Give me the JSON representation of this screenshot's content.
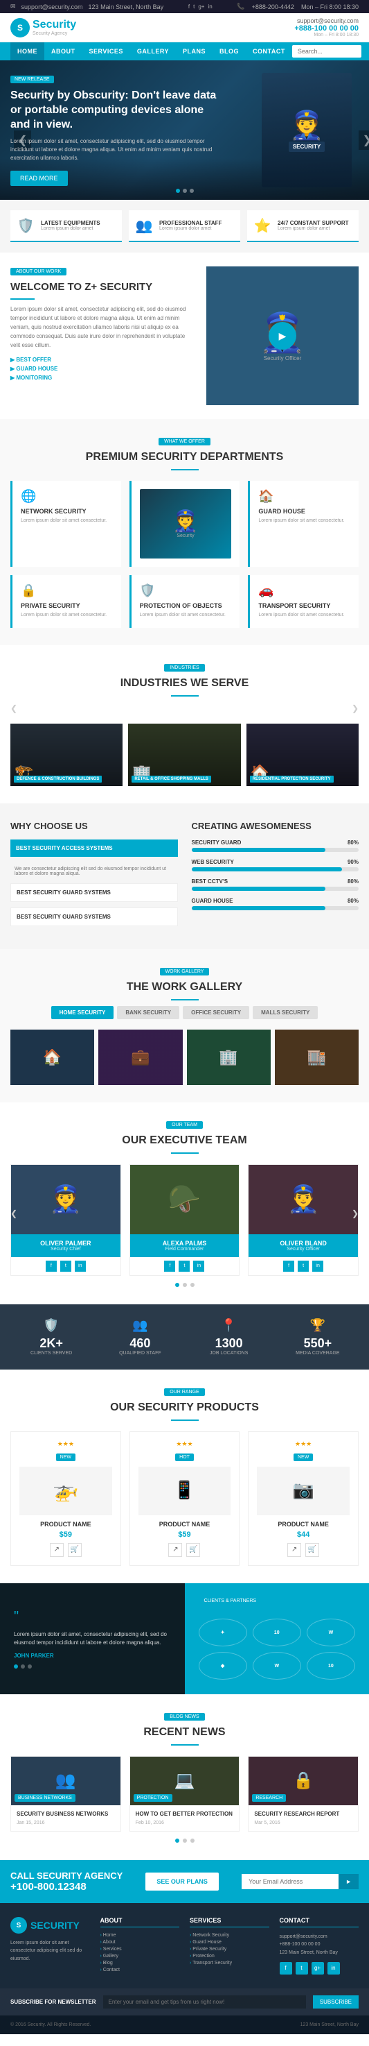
{
  "topbar": {
    "email": "support@security.com",
    "address": "123 Main Street, North Bay",
    "phone_label": "+888-200-4442",
    "hours": "Mon – Fri 8:00 18:30",
    "social": [
      "f",
      "t",
      "g+",
      "in"
    ]
  },
  "header": {
    "logo_name": "Security",
    "tagline": "Security Agency",
    "contact_label": "support@security.com",
    "phone": "+888-100 00 00 00",
    "hours": "Mon – Fri 8:00 18:30"
  },
  "nav": {
    "items": [
      "Home",
      "About",
      "Services",
      "Gallery",
      "Plans",
      "Blog",
      "Contact"
    ],
    "search_placeholder": "Search..."
  },
  "hero": {
    "badge": "NEW RELEASE",
    "title": "Security by Obscurity: Don't leave data or portable computing devices alone and in view.",
    "text": "Lorem ipsum dolor sit amet, consectetur adipiscing elit, sed do eiusmod tempor incididunt ut labore et dolore magna aliqua. Ut enim ad minim veniam quis nostrud exercitation ullamco laboris.",
    "btn_label": "READ MORE",
    "dots": 3,
    "figure_text": "SECURITY"
  },
  "features": [
    {
      "icon": "🛡️",
      "title": "LATEST EQUIPMENTS",
      "text": "Lorem ipsum dolor amet"
    },
    {
      "icon": "👥",
      "title": "PROFESSIONAL STAFF",
      "text": "Lorem ipsum dolor amet"
    },
    {
      "icon": "⭐",
      "title": "24/7 CONSTANT SUPPORT",
      "text": "Lorem ipsum dolor amet"
    }
  ],
  "welcome": {
    "badge": "ABOUT OUR WORK",
    "title": "WELCOME TO Z+ SECURITY",
    "text": "Lorem ipsum dolor sit amet, consectetur adipiscing elit, sed do eiusmod tempor incididunt ut labore et dolore magna aliqua. Ut enim ad minim veniam, quis nostrud exercitation ullamco laboris nisi ut aliquip ex ea commodo consequat. Duis aute irure dolor in reprehenderit in voluptate velit esse cillum.",
    "links": [
      "BEST OFFER",
      "GUARD HOUSE",
      "MONITORING"
    ]
  },
  "departments": {
    "badge": "WHAT WE OFFER",
    "title": "PREMIUM SECURITY DEPARTMENTS",
    "items": [
      {
        "icon": "🌐",
        "title": "NETWORK SECURITY",
        "text": "Lorem ipsum dolor sit amet consectetur."
      },
      {
        "icon": "🏠",
        "title": "GUARD HOUSE",
        "text": "Lorem ipsum dolor sit amet consectetur."
      },
      {
        "icon": "🔒",
        "title": "PRIVATE SECURITY",
        "text": "Lorem ipsum dolor sit amet consectetur."
      },
      {
        "icon": "🛡️",
        "title": "PROTECTION OF OBJECTS",
        "text": "Lorem ipsum dolor sit amet consectetur."
      },
      {
        "icon": "🚗",
        "title": "TRANSPORT SECURITY",
        "text": "Lorem ipsum dolor sit amet consectetur."
      }
    ]
  },
  "industries": {
    "badge": "INDUSTRIES",
    "title": "INDUSTRIES WE SERVE",
    "items": [
      {
        "label": "DEFENCE & CONSTRUCTION BUILDINGS",
        "color": "#3a4a5a"
      },
      {
        "label": "RETAIL & OFFICE SHOPPING MALLS",
        "color": "#4a5a3a"
      },
      {
        "label": "RESIDENTIAL PROTECTION SECURITY",
        "color": "#3a3a5a"
      }
    ]
  },
  "whychoose": {
    "title": "WHY CHOOSE US",
    "items": [
      {
        "text": "BEST SECURITY ACCESS SYSTEMS",
        "active": true
      },
      {
        "text": "BEST SECURITY GUARD SYSTEMS",
        "active": false
      },
      {
        "text": "BEST SECURITY GUARD SYSTEMS",
        "active": false
      }
    ]
  },
  "skills": {
    "title": "CREATING AWESOMENESS",
    "items": [
      {
        "label": "SECURITY GUARD",
        "percent": 80
      },
      {
        "label": "WEB SECURITY",
        "percent": 90
      },
      {
        "label": "BEST CCTV'S",
        "percent": 80
      },
      {
        "label": "GUARD HOUSE",
        "percent": 80
      }
    ]
  },
  "gallery": {
    "badge": "WORK GALLERY",
    "title": "THE WORK GALLERY",
    "tabs": [
      "HOME SECURITY",
      "BANK SECURITY",
      "OFFICE SECURITY",
      "MALLS SECURITY"
    ],
    "images": [
      "img1",
      "img2",
      "img3",
      "img4"
    ]
  },
  "team": {
    "badge": "OUR TEAM",
    "title": "OUR EXECUTIVE TEAM",
    "members": [
      {
        "name": "OLIVER PALMER",
        "role": "Security Chief",
        "photo": "p1"
      },
      {
        "name": "ALEXA PALMS",
        "role": "Field Commander",
        "photo": "p2"
      },
      {
        "name": "OLIVER BLAND",
        "role": "Security Officer",
        "photo": "p3"
      }
    ]
  },
  "stats": [
    {
      "icon": "🛡️",
      "number": "2K+",
      "label": "CLIENTS SERVED"
    },
    {
      "icon": "👥",
      "number": "460",
      "label": "QUALIFIED STAFF"
    },
    {
      "icon": "📍",
      "number": "1300",
      "label": "JOB LOCATIONS"
    },
    {
      "icon": "🏆",
      "number": "550+",
      "label": "MEDIA COVERAGE"
    }
  ],
  "products": {
    "badge": "OUR RANGE",
    "title": "OUR SECURITY PRODUCTS",
    "items": [
      {
        "stars": "★★★",
        "badge": "NEW",
        "name": "PRODUCT NAME",
        "price": "$59",
        "icon": "drone"
      },
      {
        "stars": "★★★",
        "badge": "HOT",
        "name": "PRODUCT NAME",
        "price": "$59",
        "icon": "tablet"
      },
      {
        "stars": "★★★",
        "badge": "NEW",
        "name": "PRODUCT NAME",
        "price": "$44",
        "icon": "camera"
      }
    ]
  },
  "clients": {
    "badge": "CLIENTS & PARTNERS",
    "text": "Lorem ipsum dolor sit amet, consectetur adipiscing elit, sed do eiusmod tempor incididunt ut labore et dolore magna aliqua.",
    "author": "JOHN PARKER",
    "logos": [
      "✦",
      "10",
      "W",
      "◆",
      "W",
      "10"
    ]
  },
  "news": {
    "badge": "BLOG NEWS",
    "title": "RECENT NEWS",
    "items": [
      {
        "category": "BUSINESS NETWORKS",
        "title": "SECURITY BUSINESS NETWORKS",
        "color": "n1"
      },
      {
        "category": "PROTECTION",
        "title": "HOW TO GET BETTER PROTECTION",
        "color": "n2"
      },
      {
        "category": "RESEARCH",
        "title": "SECURITY RESEARCH REPORT",
        "color": "n3"
      }
    ]
  },
  "cta": {
    "text": "CALL SECURITY AGENCY",
    "phone": "+100-800.12348",
    "btn_label": "SEE OUR PLANS",
    "input_placeholder": "Your Email Address",
    "submit_label": "►"
  },
  "footer": {
    "cols": [
      {
        "title": "SECURITY",
        "type": "logo",
        "text": "Lorem ipsum dolor sit amet consectetur adipiscing elit sed do eiusmod."
      },
      {
        "title": "ABOUT",
        "type": "links",
        "links": [
          "Home",
          "About",
          "Services",
          "Gallery",
          "Blog",
          "Contact"
        ]
      },
      {
        "title": "SERVICES",
        "type": "links",
        "links": [
          "Network Security",
          "Guard House",
          "Private Security",
          "Protection",
          "Transport Security"
        ]
      },
      {
        "title": "CONTACT",
        "type": "contact",
        "items": [
          "support@security.com",
          "+888-100 00 00 00",
          "123 Main Street, North Bay"
        ]
      }
    ],
    "copyright": "© 2016 Security. All Rights Reserved.",
    "newsletter_label": "SUBSCRIBE FOR NEWSLETTER",
    "newsletter_placeholder": "Enter your email and get tips from us right now!"
  }
}
